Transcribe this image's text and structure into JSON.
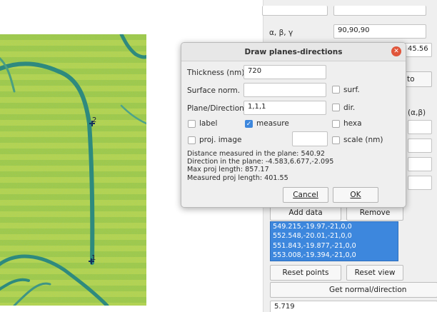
{
  "micrograph": {
    "points": [
      {
        "number": "1"
      },
      {
        "number": "2"
      }
    ]
  },
  "panel": {
    "angles_label": "α, β, γ",
    "angles_value": "90,90,90",
    "partial_value": "45.56",
    "partial_button": "to",
    "partial_label": "(α,β)",
    "add_data_button": "Add data",
    "remove_button": "Remove",
    "data_rows": [
      "549.215,-19.97,-21,0,0",
      "552.548,-20.01,-21,0,0",
      "551.843,-19.877,-21,0,0",
      "553.008,-19.394,-21,0,0"
    ],
    "reset_points_button": "Reset points",
    "reset_view_button": "Reset view",
    "get_normal_button": "Get normal/direction",
    "output_value": "5.719"
  },
  "dialog": {
    "title": "Draw planes-directions",
    "thickness_label": "Thickness (nm)",
    "thickness_value": "720",
    "surface_label": "Surface norm.",
    "surface_value": "",
    "surf_label": "surf.",
    "plane_label": "Plane/Direction",
    "plane_value": "1,1,1",
    "dir_label": "dir.",
    "label_label": "label",
    "measure_label": "measure",
    "hexa_label": "hexa",
    "proj_label": "proj. image",
    "proj_value": "",
    "scale_label": "scale (nm)",
    "info": [
      "Distance measured in the plane: 540.92",
      "Direction in the plane: -4.583,6.677,-2.095",
      "Max proj length: 857.17",
      "Measured proj length: 401.55"
    ],
    "cancel_button": "Cancel",
    "ok_button": "OK"
  }
}
